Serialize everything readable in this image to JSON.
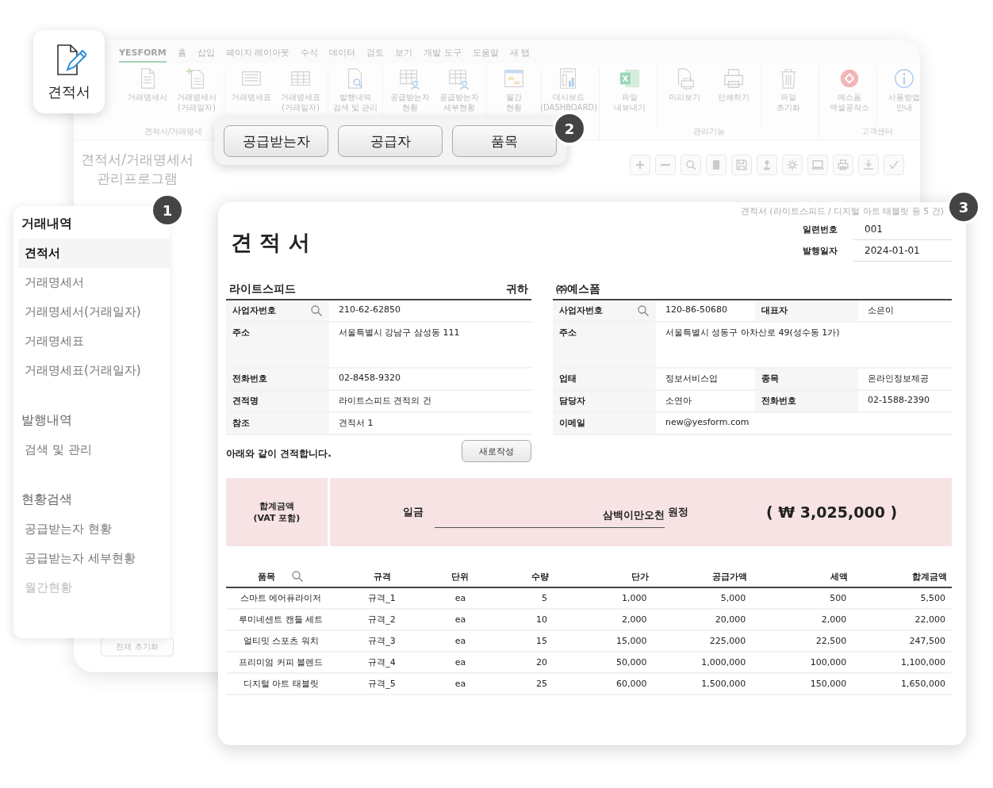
{
  "app_icon": {
    "label": "견적서"
  },
  "background_window": {
    "ribbon_tabs": [
      {
        "label": "YESFORM",
        "selected": true
      },
      {
        "label": "홈",
        "selected": false
      },
      {
        "label": "삽입",
        "selected": false
      },
      {
        "label": "페이지 레이아웃",
        "selected": false
      },
      {
        "label": "수식",
        "selected": false
      },
      {
        "label": "데이터",
        "selected": false
      },
      {
        "label": "검토",
        "selected": false
      },
      {
        "label": "보기",
        "selected": false
      },
      {
        "label": "개발 도구",
        "selected": false
      },
      {
        "label": "도움말",
        "selected": false
      },
      {
        "label": "새 탭",
        "selected": false
      }
    ],
    "ribbon_groups": [
      {
        "label": "견적서/거래명세",
        "clusters": [
          [
            {
              "lines": [
                "거래명세서"
              ]
            },
            {
              "lines": [
                "거래명세서",
                "(거래일자)"
              ]
            }
          ],
          [
            {
              "lines": [
                "거래명세표"
              ]
            },
            {
              "lines": [
                "거래명세표",
                "(거래일자)"
              ]
            }
          ],
          [
            {
              "lines": [
                "발행내역",
                "검색 및 관리"
              ]
            }
          ],
          [
            {
              "lines": [
                "공급받는자",
                "현황"
              ]
            },
            {
              "lines": [
                "공급받는자",
                "세부현황"
              ]
            }
          ],
          [
            {
              "lines": [
                "월간",
                "현황"
              ]
            }
          ],
          [
            {
              "lines": [
                "대시보드",
                "(DASHBOARD)"
              ]
            }
          ]
        ]
      },
      {
        "label": "관리기능",
        "clusters": [
          [
            {
              "lines": [
                "파일",
                "내보내기"
              ]
            }
          ],
          [
            {
              "lines": [
                "미리보기"
              ]
            },
            {
              "lines": [
                "인쇄하기"
              ]
            }
          ],
          [
            {
              "lines": [
                "파일",
                "초기화"
              ]
            }
          ]
        ]
      },
      {
        "label": "고객센터",
        "clusters": [
          [
            {
              "lines": [
                "예스폼",
                "엑셀공작소"
              ]
            }
          ],
          [
            {
              "lines": [
                "사용방법",
                "안내"
              ]
            }
          ]
        ]
      }
    ],
    "title_lines": [
      "견적서/거래명세서",
      "관리프로그램"
    ],
    "reset_button": "전체 초기화"
  },
  "popup": {
    "buttons": [
      "공급받는자",
      "공급자",
      "품목"
    ]
  },
  "badges": [
    "1",
    "2",
    "3"
  ],
  "sidebar": {
    "sections": [
      {
        "title": "거래내역",
        "items": [
          {
            "label": "견적서",
            "selected": true
          },
          {
            "label": "거래명세서",
            "selected": false
          },
          {
            "label": "거래명세서(거래일자)",
            "selected": false
          },
          {
            "label": "거래명세표",
            "selected": false
          },
          {
            "label": "거래명세표(거래일자)",
            "selected": false
          }
        ]
      },
      {
        "title": "발행내역",
        "items": [
          {
            "label": "검색 및 관리",
            "selected": false
          }
        ]
      },
      {
        "title": "현황검색",
        "items": [
          {
            "label": "공급받는자 현황",
            "selected": false
          },
          {
            "label": "공급받는자 세부현황",
            "selected": false
          },
          {
            "label": "월간현황",
            "selected": false
          }
        ]
      }
    ]
  },
  "quote": {
    "caption": "견적서 (라이트스피드 / 디지털 아트 태블릿 등 5 건)",
    "title": "견 적 서",
    "meta": [
      {
        "label": "일련번호",
        "value": "001"
      },
      {
        "label": "발행일자",
        "value": "2024-01-01"
      }
    ],
    "recipient": {
      "name": "라이트스피드",
      "suffix": "귀하",
      "rows": [
        {
          "label": "사업자번호",
          "value": "210-62-62850"
        },
        {
          "label": "주소",
          "value": "서울특별시 강남구 삼성동 111"
        },
        {
          "label": "전화번호",
          "value": "02-8458-9320"
        },
        {
          "label": "견적명",
          "value": "라이트스피드 견적의 건"
        },
        {
          "label": "참조",
          "value": "견적서 1"
        }
      ]
    },
    "supplier": {
      "name": "㈜예스폼",
      "rows": [
        {
          "label": "사업자번호",
          "value": "120-86-50680",
          "label2": "대표자",
          "value2": "소은이"
        },
        {
          "label": "주소",
          "value": "서울특별시 성동구 아차산로 49(성수동 1가)"
        },
        {
          "label": "업태",
          "value": "정보서비스업",
          "label2": "종목",
          "value2": "온라인정보제공"
        },
        {
          "label": "담당자",
          "value": "소연아",
          "label2": "전화번호",
          "value2": "02-1588-2390"
        },
        {
          "label": "이메일",
          "value": "new@yesform.com"
        }
      ]
    },
    "note": "아래와 같이 견적합니다.",
    "new_button": "새로작성",
    "total": {
      "label_lines": [
        "합계금액",
        "(VAT 포함)"
      ],
      "prefix": "일금",
      "amount_words": "삼백이만오천",
      "suffix": "원정",
      "amount": "( ₩ 3,025,000 )"
    },
    "items": {
      "columns": [
        "품목",
        "규격",
        "단위",
        "수량",
        "단가",
        "공급가액",
        "세액",
        "합계금액"
      ],
      "rows": [
        [
          "스마트 에어퓨라이저",
          "규격_1",
          "ea",
          "5",
          "1,000",
          "5,000",
          "500",
          "5,500"
        ],
        [
          "루미네센트 캔들 세트",
          "규격_2",
          "ea",
          "10",
          "2,000",
          "20,000",
          "2,000",
          "22,000"
        ],
        [
          "얼티밋 스포츠 워치",
          "규격_3",
          "ea",
          "15",
          "15,000",
          "225,000",
          "22,500",
          "247,500"
        ],
        [
          "프리미엄 커피 블렌드",
          "규격_4",
          "ea",
          "20",
          "50,000",
          "1,000,000",
          "100,000",
          "1,100,000"
        ],
        [
          "디지털 아트 태블릿",
          "규격_5",
          "ea",
          "25",
          "60,000",
          "1,500,000",
          "150,000",
          "1,650,000"
        ]
      ]
    }
  }
}
